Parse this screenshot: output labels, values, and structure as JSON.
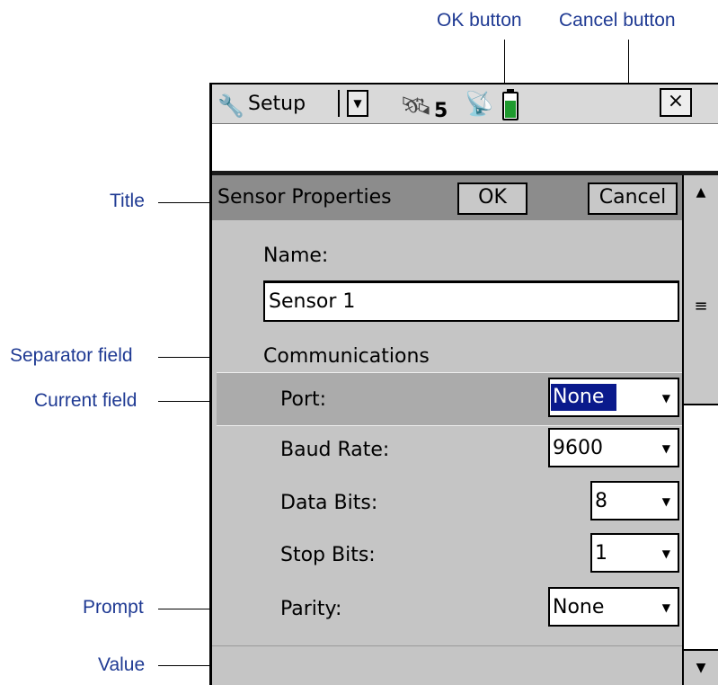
{
  "annotations": {
    "ok": "OK button",
    "cancel": "Cancel button",
    "title": "Title",
    "separator": "Separator field",
    "current": "Current field",
    "prompt": "Prompt",
    "value": "Value"
  },
  "taskbar": {
    "menu_label": "Setup",
    "satellite_count": "5",
    "close_label": "×"
  },
  "form": {
    "title": "Sensor Properties",
    "ok_label": "OK",
    "cancel_label": "Cancel",
    "name_label": "Name:",
    "name_value": "Sensor 1",
    "section": "Communications",
    "fields": [
      {
        "prompt": "Port:",
        "value": "None"
      },
      {
        "prompt": "Baud Rate:",
        "value": "9600"
      },
      {
        "prompt": "Data Bits:",
        "value": "8"
      },
      {
        "prompt": "Stop Bits:",
        "value": "1"
      },
      {
        "prompt": "Parity:",
        "value": "None"
      }
    ]
  },
  "colors": {
    "callout_text": "#1f3a93",
    "selection": "#0a1a8c",
    "battery": "#1e9a2e"
  },
  "icons": [
    "wrench-icon",
    "chevron-down-icon",
    "satellite-icon",
    "radio-icon",
    "battery-icon",
    "close-icon",
    "scroll-up-icon",
    "scroll-down-icon",
    "scroll-grip-icon"
  ]
}
